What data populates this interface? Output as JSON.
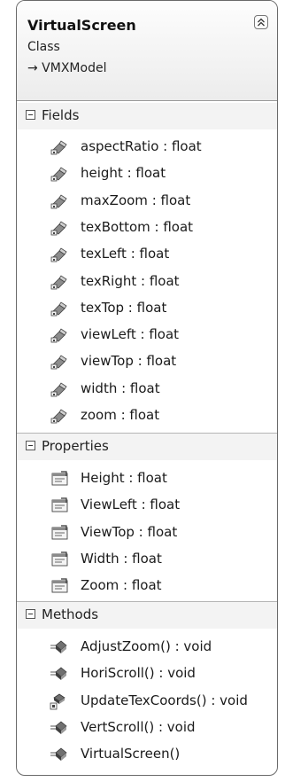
{
  "class_box": {
    "title": "VirtualScreen",
    "stereotype": "Class",
    "base": "→ VMXModel"
  },
  "sections": {
    "fields": {
      "label": "Fields",
      "items": [
        "aspectRatio : float",
        "height : float",
        "maxZoom : float",
        "texBottom : float",
        "texLeft : float",
        "texRight : float",
        "texTop : float",
        "viewLeft : float",
        "viewTop : float",
        "width : float",
        "zoom : float"
      ]
    },
    "properties": {
      "label": "Properties",
      "items": [
        "Height : float",
        "ViewLeft : float",
        "ViewTop : float",
        "Width : float",
        "Zoom : float"
      ]
    },
    "methods": {
      "label": "Methods",
      "items": [
        "AdjustZoom() : void",
        "HoriScroll() : void",
        "UpdateTexCoords() : void",
        "VertScroll() : void",
        "VirtualScreen()"
      ]
    }
  },
  "icons": {
    "collapse": "double-chevron-up-icon",
    "field": "private-field-icon",
    "property": "property-icon",
    "method_public": "public-method-icon",
    "method_private": "private-method-icon"
  }
}
